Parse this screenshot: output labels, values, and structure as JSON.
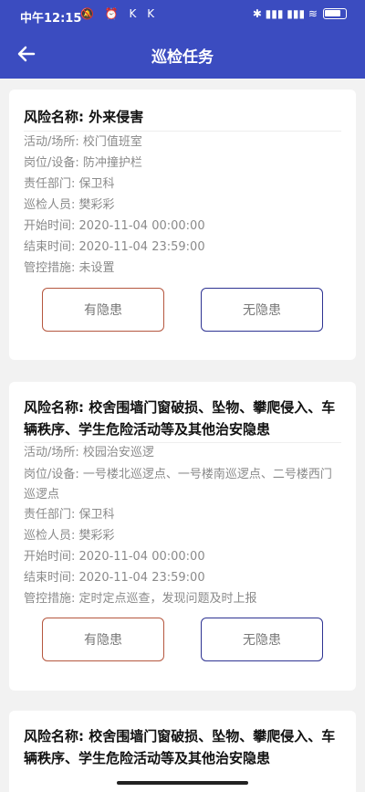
{
  "status_bar": {
    "time": "中午12:15",
    "left_icons": "🔕 ⏰ K K",
    "right_icons": "✱ ▮▮▮ ▮▮▮ ≋"
  },
  "header": {
    "title": "巡检任务"
  },
  "labels": {
    "risk_name": "风险名称: ",
    "activity": "活动/场所: ",
    "post": "岗位/设备: ",
    "department": "责任部门: ",
    "inspector": "巡检人员: ",
    "start_time": "开始时间: ",
    "end_time": "结束时间: ",
    "measures": "管控措施: "
  },
  "buttons": {
    "has_hazard": "有隐患",
    "no_hazard": "无隐患"
  },
  "tasks": [
    {
      "risk_name": "外来侵害",
      "activity": "校门值班室",
      "post": "防冲撞护栏",
      "department": "保卫科",
      "inspector": "樊彩彩",
      "start_time": "2020-11-04 00:00:00",
      "end_time": "2020-11-04 23:59:00",
      "measures": "未设置"
    },
    {
      "risk_name": "校舍围墙门窗破损、坠物、攀爬侵入、车辆秩序、学生危险活动等及其他治安隐患",
      "activity": "校园治安巡逻",
      "post": "一号楼北巡逻点、一号楼南巡逻点、二号楼西门巡逻点",
      "department": "保卫科",
      "inspector": "樊彩彩",
      "start_time": "2020-11-04 00:00:00",
      "end_time": "2020-11-04 23:59:00",
      "measures": "定时定点巡查，发现问题及时上报"
    },
    {
      "risk_name": "校舍围墙门窗破损、坠物、攀爬侵入、车辆秩序、学生危险活动等及其他治安隐患"
    }
  ]
}
